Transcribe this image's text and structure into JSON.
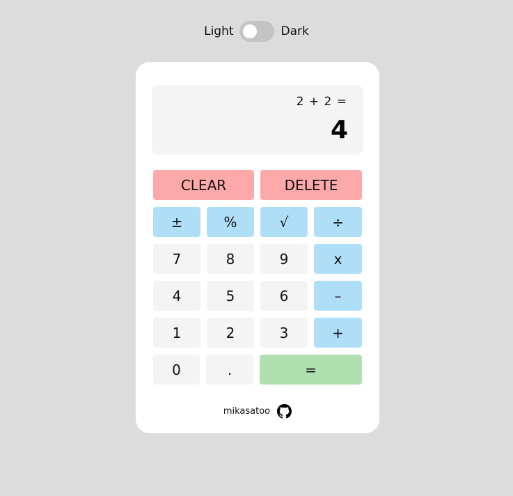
{
  "theme_toggle": {
    "light_label": "Light",
    "dark_label": "Dark",
    "state": "light"
  },
  "display": {
    "expression": "2 + 2 =",
    "result": "4"
  },
  "keys": {
    "clear": "CLEAR",
    "delete": "DELETE",
    "plus_minus": "±",
    "percent": "%",
    "sqrt": "√",
    "divide": "÷",
    "seven": "7",
    "eight": "8",
    "nine": "9",
    "multiply": "x",
    "four": "4",
    "five": "5",
    "six": "6",
    "subtract": "–",
    "one": "1",
    "two": "2",
    "three": "3",
    "add": "+",
    "zero": "0",
    "decimal": ".",
    "equals": "="
  },
  "footer": {
    "author": "mikasatoo",
    "icon": "github-icon"
  },
  "colors": {
    "page_background": "#dcdcdc",
    "card": "#ffffff",
    "number_key": "#f4f4f4",
    "operator_key": "#aedff7",
    "clear_key": "#fda9aa",
    "equals_key": "#b0e0af"
  }
}
